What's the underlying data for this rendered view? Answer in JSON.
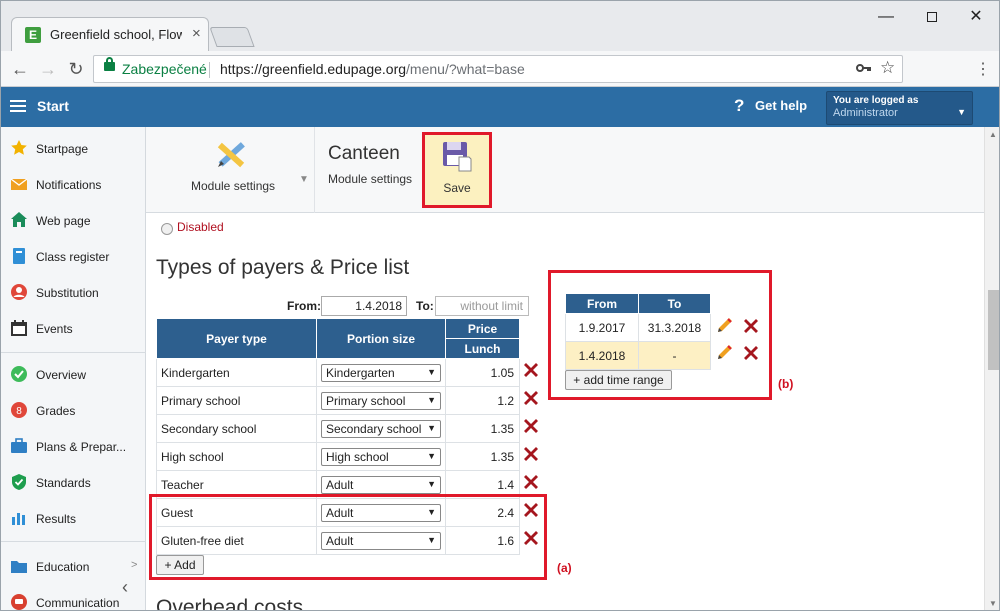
{
  "browser": {
    "tab_title": "Greenfield school, Flowers",
    "tab_favicon": "E",
    "secure_label": "Zabezpečené",
    "url_host": "https://greenfield.edupage.org",
    "url_path": "/menu/?what=base"
  },
  "header": {
    "start_label": "Start",
    "help_label": "Get help",
    "logged_in_label": "You are logged as",
    "user_name": "Administrator"
  },
  "sidebar": {
    "items": [
      {
        "label": "Startpage",
        "icon": "star-icon"
      },
      {
        "label": "Notifications",
        "icon": "envelope-icon"
      },
      {
        "label": "Web page",
        "icon": "house-icon"
      },
      {
        "label": "Class register",
        "icon": "book-icon"
      },
      {
        "label": "Substitution",
        "icon": "person-icon"
      },
      {
        "label": "Events",
        "icon": "calendar-icon"
      },
      {
        "label": "Overview",
        "icon": "check-circle-icon"
      },
      {
        "label": "Grades",
        "icon": "grades-icon"
      },
      {
        "label": "Plans & Prepar...",
        "icon": "briefcase-icon"
      },
      {
        "label": "Standards",
        "icon": "shield-check-icon"
      },
      {
        "label": "Results",
        "icon": "bar-chart-icon"
      },
      {
        "label": "Education",
        "icon": "folder-icon"
      },
      {
        "label": "Communication",
        "icon": "chat-icon"
      }
    ]
  },
  "ribbon": {
    "module_settings": "Module settings",
    "canteen_title": "Canteen",
    "canteen_sub": "Module settings",
    "save_label": "Save"
  },
  "content": {
    "disabled_label": "Disabled",
    "types_heading": "Types of payers & Price list",
    "from_label": "From:",
    "from_value": "1.4.2018",
    "to_label": "To:",
    "to_placeholder": "without limit",
    "columns": {
      "payer_type": "Payer type",
      "portion_size": "Portion size",
      "price": "Price",
      "lunch": "Lunch"
    },
    "rows": [
      {
        "payer": "Kindergarten",
        "portion": "Kindergarten",
        "price": "1.05"
      },
      {
        "payer": "Primary school",
        "portion": "Primary school",
        "price": "1.2"
      },
      {
        "payer": "Secondary school",
        "portion": "Secondary school",
        "price": "1.35"
      },
      {
        "payer": "High school",
        "portion": "High school",
        "price": "1.35"
      },
      {
        "payer": "Teacher",
        "portion": "Adult",
        "price": "1.4"
      },
      {
        "payer": "Guest",
        "portion": "Adult",
        "price": "2.4"
      },
      {
        "payer": "Gluten-free diet",
        "portion": "Adult",
        "price": "1.6"
      }
    ],
    "add_label": "+ Add",
    "annotation_a": "(a)",
    "ranges": {
      "from_header": "From",
      "to_header": "To",
      "rows": [
        {
          "from": "1.9.2017",
          "to": "31.3.2018"
        },
        {
          "from": "1.4.2018",
          "to": "-"
        }
      ],
      "add_range_label": "+ add time range"
    },
    "annotation_b": "(b)",
    "overhead_heading": "Overhead costs"
  },
  "colors": {
    "appbar": "#2c6da4",
    "table_header": "#2d5f8e",
    "highlight_red": "#e0192a",
    "selected_row": "#fdf0c4"
  }
}
